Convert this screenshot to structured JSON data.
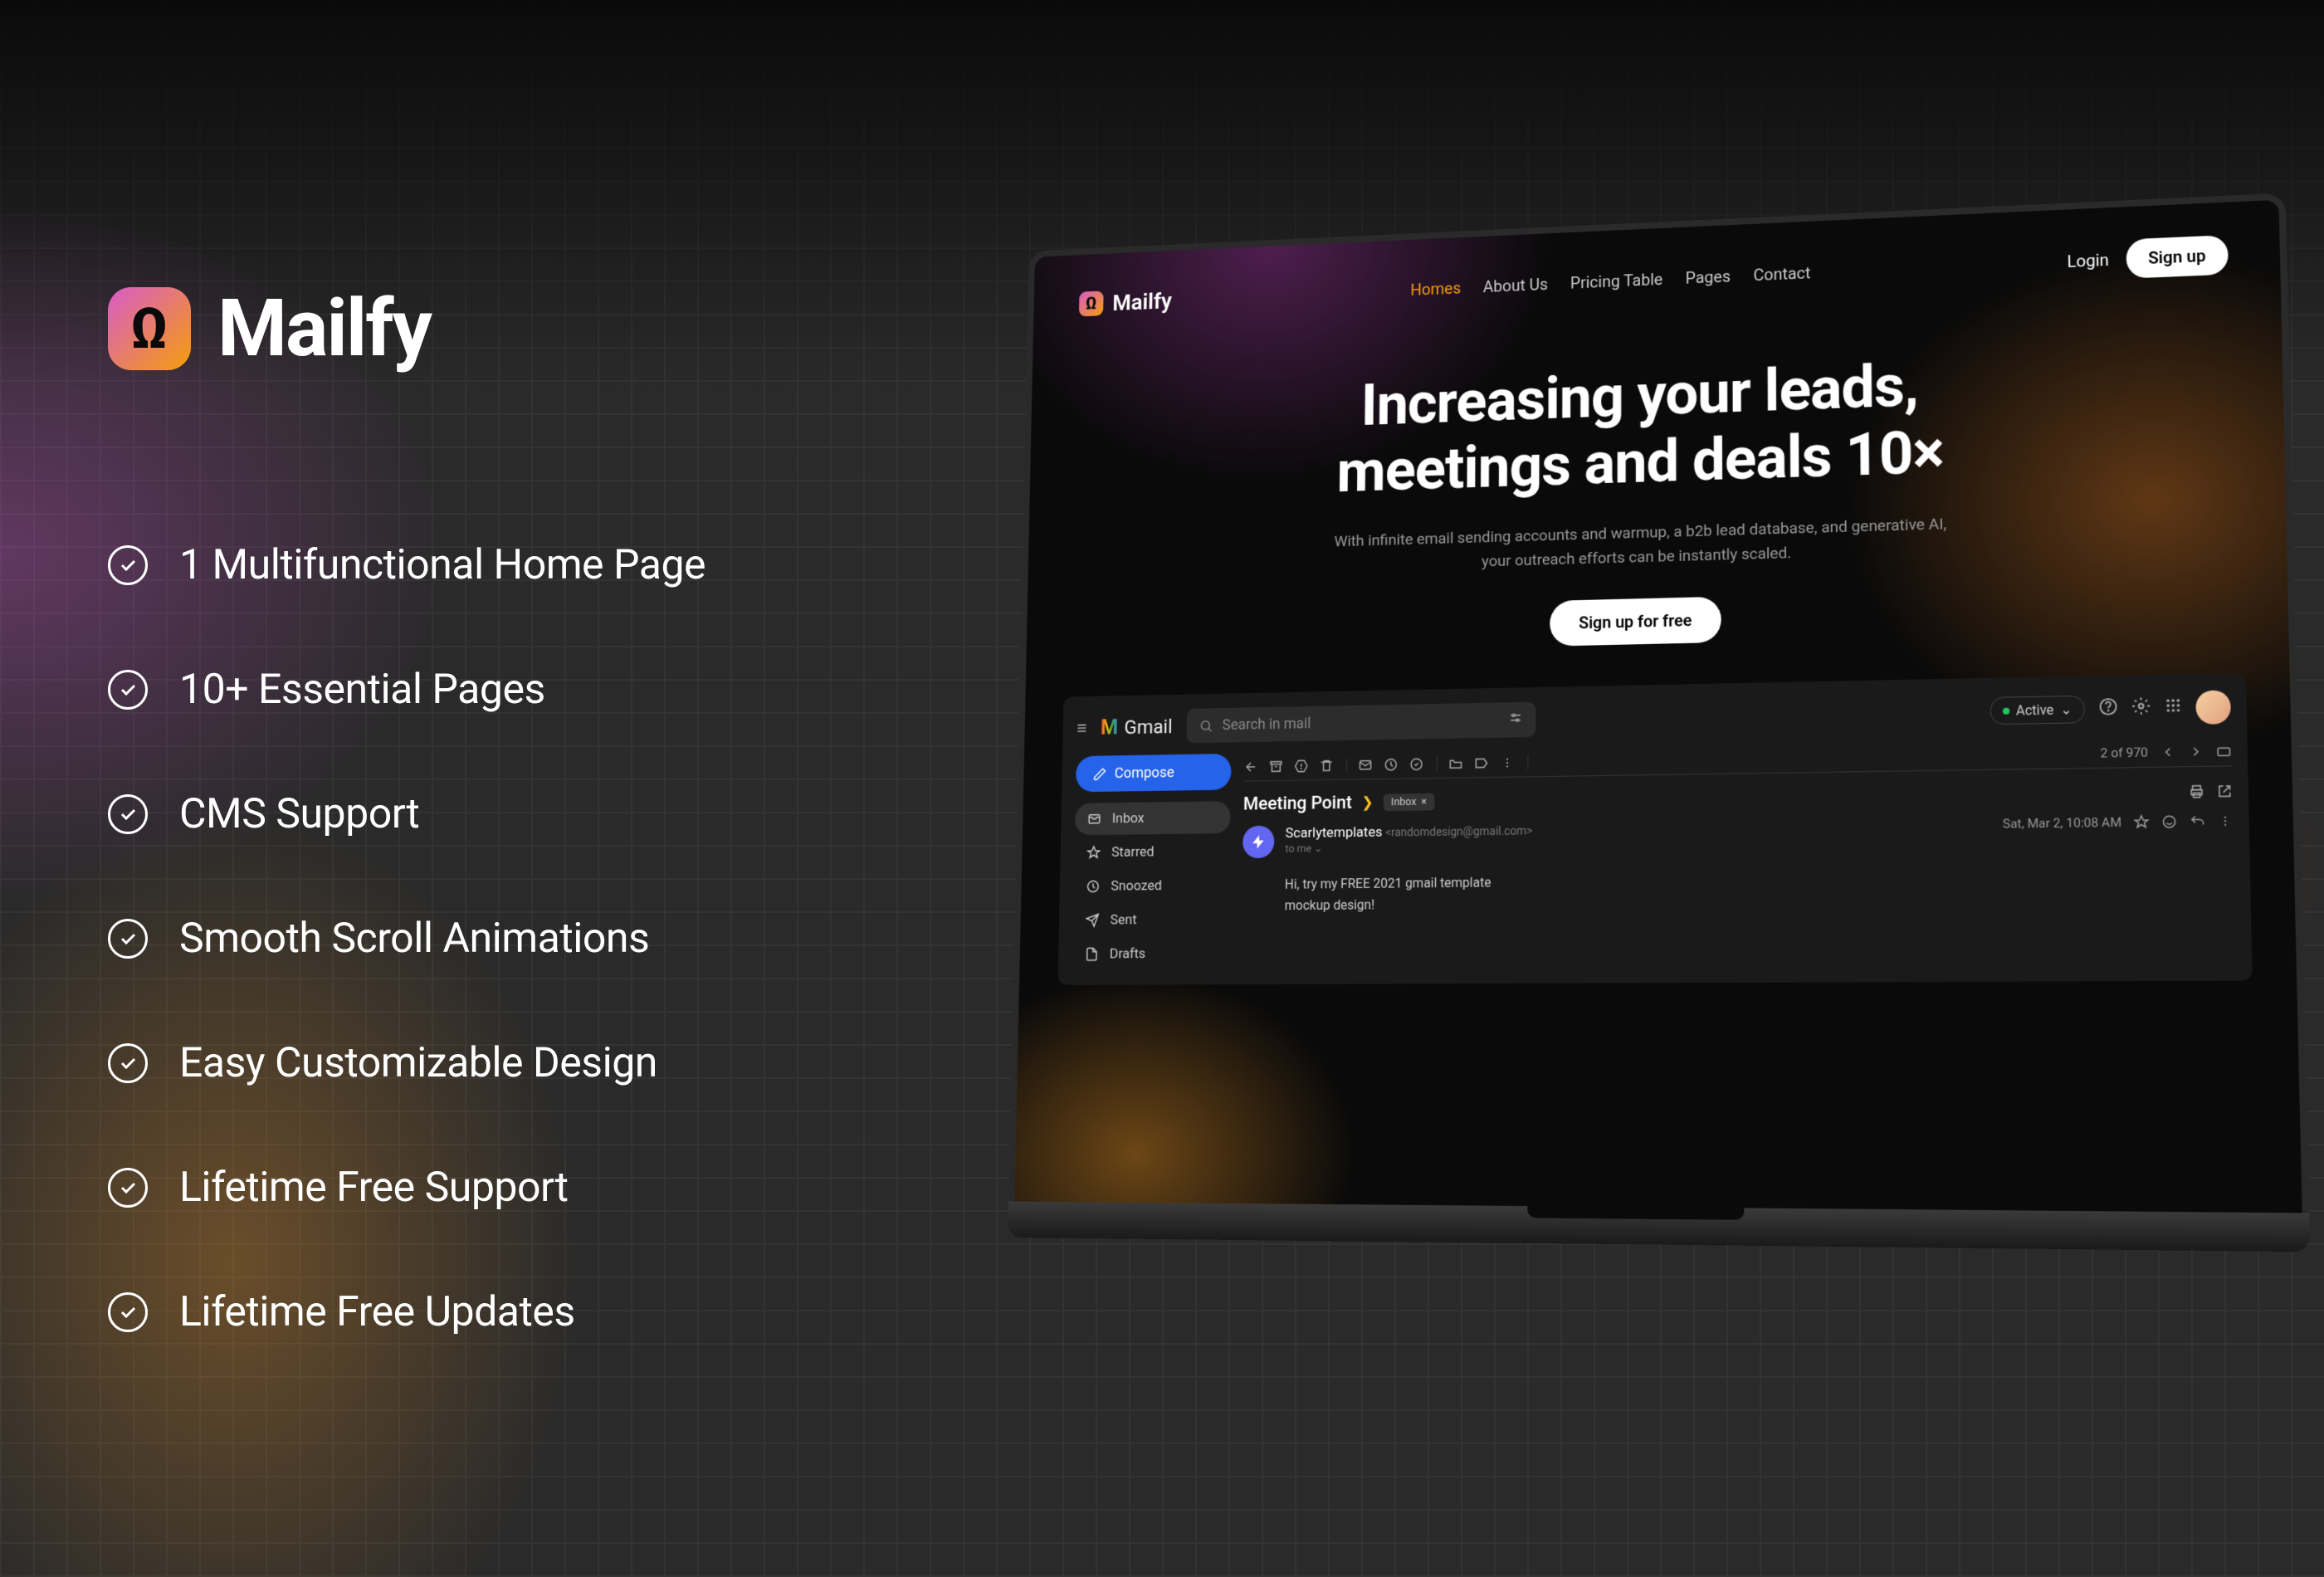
{
  "brand": {
    "name": "Mailfy",
    "glyph": "Ω"
  },
  "features": [
    "1 Multifunctional Home Page",
    "10+ Essential Pages",
    "CMS Support",
    "Smooth Scroll Animations",
    "Easy Customizable Design",
    "Lifetime Free Support",
    "Lifetime Free Updates"
  ],
  "laptop": {
    "nav": {
      "brand": {
        "name": "Mailfy",
        "glyph": "Ω"
      },
      "links": [
        "Homes",
        "About Us",
        "Pricing Table",
        "Pages",
        "Contact"
      ],
      "active_index": 0,
      "login": "Login",
      "signup": "Sign up"
    },
    "hero": {
      "title_line1": "Increasing your leads,",
      "title_line2": "meetings and deals 10×",
      "subtitle": "With infinite email sending accounts and warmup, a b2b lead database, and generative AI, your outreach efforts can be instantly scaled.",
      "cta": "Sign up for free"
    },
    "gmail": {
      "name": "Gmail",
      "search_placeholder": "Search in mail",
      "status": "Active",
      "compose": "Compose",
      "sidebar": [
        {
          "icon": "inbox",
          "label": "Inbox",
          "active": true
        },
        {
          "icon": "star",
          "label": "Starred"
        },
        {
          "icon": "clock",
          "label": "Snoozed"
        },
        {
          "icon": "send",
          "label": "Sent"
        },
        {
          "icon": "file",
          "label": "Drafts"
        }
      ],
      "count": "2 of 970",
      "subject": "Meeting Point",
      "inbox_label": "Inbox",
      "from_name": "Scarlytemplates",
      "from_email": "<randomdesign@gmail.com>",
      "to": "to me",
      "date": "Sat, Mar 2, 10:08 AM",
      "body_line1": "Hi, try my FREE 2021 gmail template",
      "body_line2": "mockup design!"
    }
  }
}
